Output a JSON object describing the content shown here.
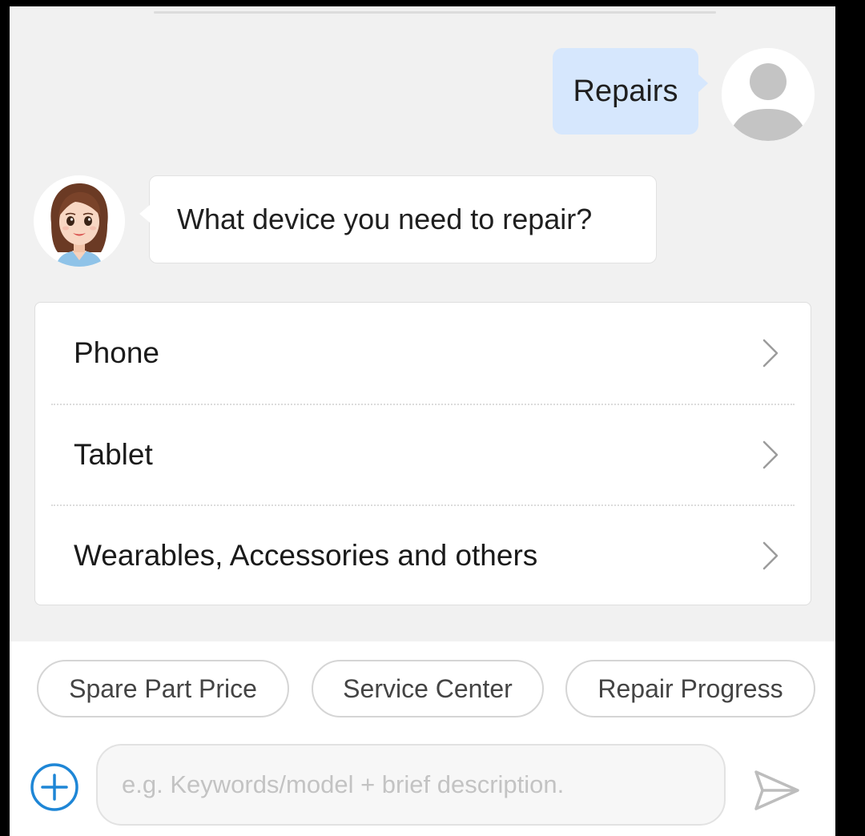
{
  "conversation": {
    "user_message": "Repairs",
    "bot_message": "What device you need to repair?"
  },
  "options": [
    {
      "label": "Phone"
    },
    {
      "label": "Tablet"
    },
    {
      "label": "Wearables, Accessories and others"
    }
  ],
  "quick_replies": [
    {
      "label": "Spare Part Price"
    },
    {
      "label": "Service Center"
    },
    {
      "label": "Repair Progress"
    }
  ],
  "input": {
    "value": "",
    "placeholder": "e.g. Keywords/model + brief description."
  },
  "icons": {
    "user_avatar": "default-user-avatar-icon",
    "bot_avatar": "assistant-avatar",
    "option_chevron": "chevron-right-icon",
    "add": "plus-circle-icon",
    "send": "send-icon"
  },
  "colors": {
    "user_bubble": "#d6e7fd",
    "chat_background": "#f1f1f1",
    "accent_blue": "#1e86d6"
  }
}
